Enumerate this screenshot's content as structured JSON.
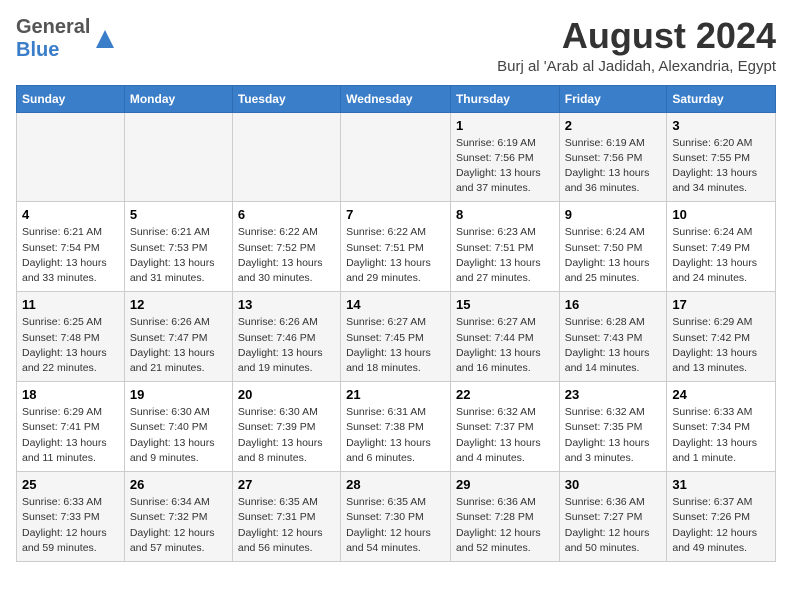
{
  "header": {
    "logo_general": "General",
    "logo_blue": "Blue",
    "title": "August 2024",
    "subtitle": "Burj al 'Arab al Jadidah, Alexandria, Egypt"
  },
  "weekdays": [
    "Sunday",
    "Monday",
    "Tuesday",
    "Wednesday",
    "Thursday",
    "Friday",
    "Saturday"
  ],
  "weeks": [
    [
      {
        "day": "",
        "info": ""
      },
      {
        "day": "",
        "info": ""
      },
      {
        "day": "",
        "info": ""
      },
      {
        "day": "",
        "info": ""
      },
      {
        "day": "1",
        "info": "Sunrise: 6:19 AM\nSunset: 7:56 PM\nDaylight: 13 hours\nand 37 minutes."
      },
      {
        "day": "2",
        "info": "Sunrise: 6:19 AM\nSunset: 7:56 PM\nDaylight: 13 hours\nand 36 minutes."
      },
      {
        "day": "3",
        "info": "Sunrise: 6:20 AM\nSunset: 7:55 PM\nDaylight: 13 hours\nand 34 minutes."
      }
    ],
    [
      {
        "day": "4",
        "info": "Sunrise: 6:21 AM\nSunset: 7:54 PM\nDaylight: 13 hours\nand 33 minutes."
      },
      {
        "day": "5",
        "info": "Sunrise: 6:21 AM\nSunset: 7:53 PM\nDaylight: 13 hours\nand 31 minutes."
      },
      {
        "day": "6",
        "info": "Sunrise: 6:22 AM\nSunset: 7:52 PM\nDaylight: 13 hours\nand 30 minutes."
      },
      {
        "day": "7",
        "info": "Sunrise: 6:22 AM\nSunset: 7:51 PM\nDaylight: 13 hours\nand 29 minutes."
      },
      {
        "day": "8",
        "info": "Sunrise: 6:23 AM\nSunset: 7:51 PM\nDaylight: 13 hours\nand 27 minutes."
      },
      {
        "day": "9",
        "info": "Sunrise: 6:24 AM\nSunset: 7:50 PM\nDaylight: 13 hours\nand 25 minutes."
      },
      {
        "day": "10",
        "info": "Sunrise: 6:24 AM\nSunset: 7:49 PM\nDaylight: 13 hours\nand 24 minutes."
      }
    ],
    [
      {
        "day": "11",
        "info": "Sunrise: 6:25 AM\nSunset: 7:48 PM\nDaylight: 13 hours\nand 22 minutes."
      },
      {
        "day": "12",
        "info": "Sunrise: 6:26 AM\nSunset: 7:47 PM\nDaylight: 13 hours\nand 21 minutes."
      },
      {
        "day": "13",
        "info": "Sunrise: 6:26 AM\nSunset: 7:46 PM\nDaylight: 13 hours\nand 19 minutes."
      },
      {
        "day": "14",
        "info": "Sunrise: 6:27 AM\nSunset: 7:45 PM\nDaylight: 13 hours\nand 18 minutes."
      },
      {
        "day": "15",
        "info": "Sunrise: 6:27 AM\nSunset: 7:44 PM\nDaylight: 13 hours\nand 16 minutes."
      },
      {
        "day": "16",
        "info": "Sunrise: 6:28 AM\nSunset: 7:43 PM\nDaylight: 13 hours\nand 14 minutes."
      },
      {
        "day": "17",
        "info": "Sunrise: 6:29 AM\nSunset: 7:42 PM\nDaylight: 13 hours\nand 13 minutes."
      }
    ],
    [
      {
        "day": "18",
        "info": "Sunrise: 6:29 AM\nSunset: 7:41 PM\nDaylight: 13 hours\nand 11 minutes."
      },
      {
        "day": "19",
        "info": "Sunrise: 6:30 AM\nSunset: 7:40 PM\nDaylight: 13 hours\nand 9 minutes."
      },
      {
        "day": "20",
        "info": "Sunrise: 6:30 AM\nSunset: 7:39 PM\nDaylight: 13 hours\nand 8 minutes."
      },
      {
        "day": "21",
        "info": "Sunrise: 6:31 AM\nSunset: 7:38 PM\nDaylight: 13 hours\nand 6 minutes."
      },
      {
        "day": "22",
        "info": "Sunrise: 6:32 AM\nSunset: 7:37 PM\nDaylight: 13 hours\nand 4 minutes."
      },
      {
        "day": "23",
        "info": "Sunrise: 6:32 AM\nSunset: 7:35 PM\nDaylight: 13 hours\nand 3 minutes."
      },
      {
        "day": "24",
        "info": "Sunrise: 6:33 AM\nSunset: 7:34 PM\nDaylight: 13 hours\nand 1 minute."
      }
    ],
    [
      {
        "day": "25",
        "info": "Sunrise: 6:33 AM\nSunset: 7:33 PM\nDaylight: 12 hours\nand 59 minutes."
      },
      {
        "day": "26",
        "info": "Sunrise: 6:34 AM\nSunset: 7:32 PM\nDaylight: 12 hours\nand 57 minutes."
      },
      {
        "day": "27",
        "info": "Sunrise: 6:35 AM\nSunset: 7:31 PM\nDaylight: 12 hours\nand 56 minutes."
      },
      {
        "day": "28",
        "info": "Sunrise: 6:35 AM\nSunset: 7:30 PM\nDaylight: 12 hours\nand 54 minutes."
      },
      {
        "day": "29",
        "info": "Sunrise: 6:36 AM\nSunset: 7:28 PM\nDaylight: 12 hours\nand 52 minutes."
      },
      {
        "day": "30",
        "info": "Sunrise: 6:36 AM\nSunset: 7:27 PM\nDaylight: 12 hours\nand 50 minutes."
      },
      {
        "day": "31",
        "info": "Sunrise: 6:37 AM\nSunset: 7:26 PM\nDaylight: 12 hours\nand 49 minutes."
      }
    ]
  ]
}
